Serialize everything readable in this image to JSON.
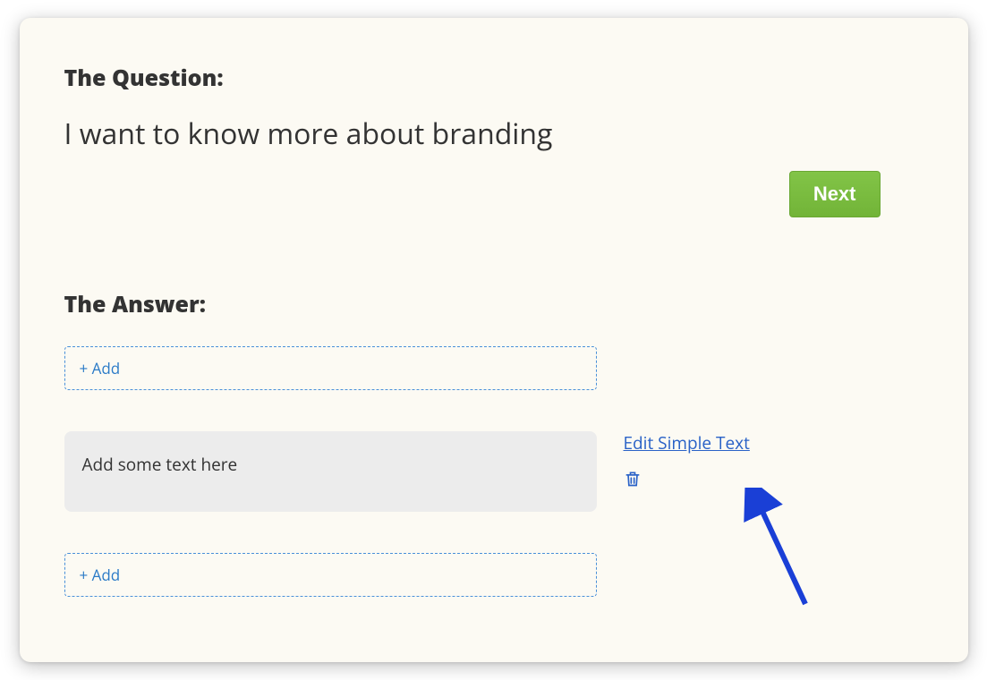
{
  "question": {
    "label": "The Question:",
    "text": "I want to know more about branding"
  },
  "next_button_label": "Next",
  "answer": {
    "label": "The Answer:",
    "add_label_top": "+ Add",
    "add_label_bottom": "+ Add",
    "text_block_placeholder": "Add some text here",
    "edit_link_label": "Edit Simple Text"
  }
}
